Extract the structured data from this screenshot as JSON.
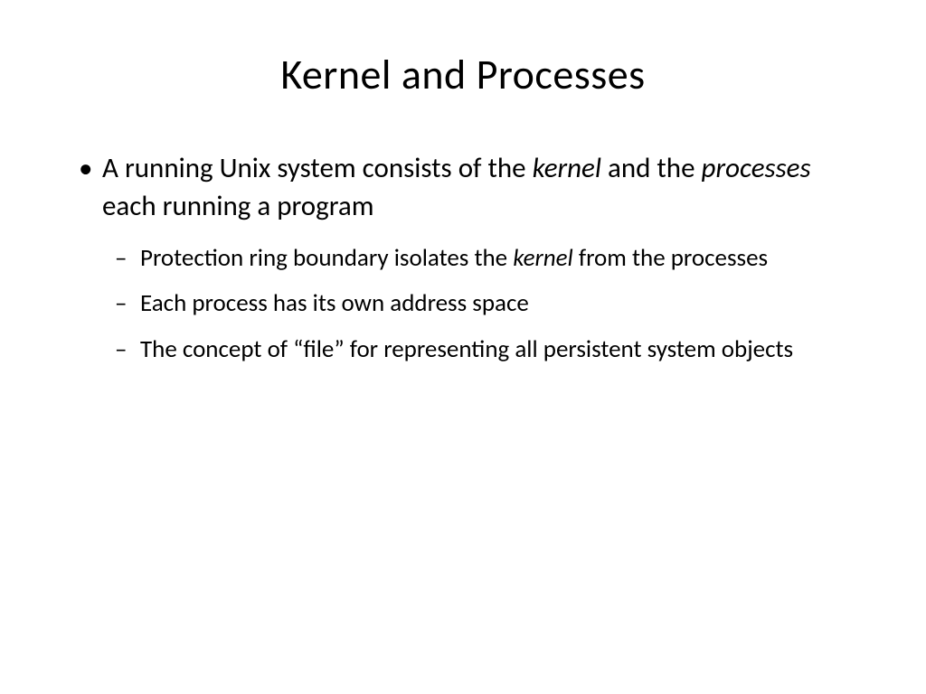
{
  "slide": {
    "title": "Kernel and Processes",
    "b1_p1": "A running Unix system consists of the ",
    "b1_i1": "kernel",
    "b1_p2": " and the ",
    "b1_i2": "processes",
    "b1_p3": " each running a program",
    "b2_p1": "Protection ring boundary isolates the ",
    "b2_i1": "kernel",
    "b2_p2": " from the processes",
    "b3": "Each process has its own address space",
    "b4": "The concept of “file” for representing all persistent system objects"
  }
}
